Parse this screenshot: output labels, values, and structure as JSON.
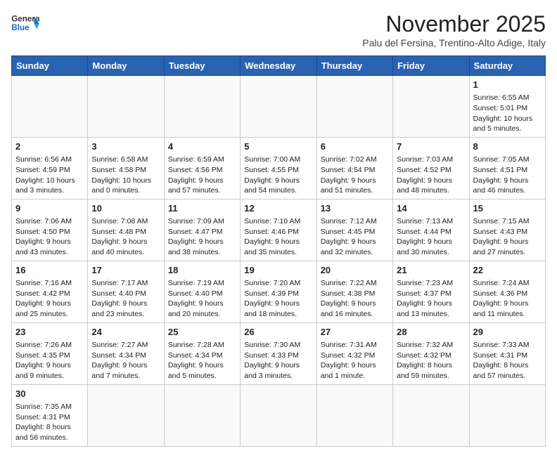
{
  "header": {
    "logo_general": "General",
    "logo_blue": "Blue",
    "month_title": "November 2025",
    "subtitle": "Palu del Fersina, Trentino-Alto Adige, Italy"
  },
  "days_of_week": [
    "Sunday",
    "Monday",
    "Tuesday",
    "Wednesday",
    "Thursday",
    "Friday",
    "Saturday"
  ],
  "weeks": [
    [
      {
        "day": "",
        "info": ""
      },
      {
        "day": "",
        "info": ""
      },
      {
        "day": "",
        "info": ""
      },
      {
        "day": "",
        "info": ""
      },
      {
        "day": "",
        "info": ""
      },
      {
        "day": "",
        "info": ""
      },
      {
        "day": "1",
        "info": "Sunrise: 6:55 AM\nSunset: 5:01 PM\nDaylight: 10 hours and 5 minutes."
      }
    ],
    [
      {
        "day": "2",
        "info": "Sunrise: 6:56 AM\nSunset: 4:59 PM\nDaylight: 10 hours and 3 minutes."
      },
      {
        "day": "3",
        "info": "Sunrise: 6:58 AM\nSunset: 4:58 PM\nDaylight: 10 hours and 0 minutes."
      },
      {
        "day": "4",
        "info": "Sunrise: 6:59 AM\nSunset: 4:56 PM\nDaylight: 9 hours and 57 minutes."
      },
      {
        "day": "5",
        "info": "Sunrise: 7:00 AM\nSunset: 4:55 PM\nDaylight: 9 hours and 54 minutes."
      },
      {
        "day": "6",
        "info": "Sunrise: 7:02 AM\nSunset: 4:54 PM\nDaylight: 9 hours and 51 minutes."
      },
      {
        "day": "7",
        "info": "Sunrise: 7:03 AM\nSunset: 4:52 PM\nDaylight: 9 hours and 48 minutes."
      },
      {
        "day": "8",
        "info": "Sunrise: 7:05 AM\nSunset: 4:51 PM\nDaylight: 9 hours and 46 minutes."
      }
    ],
    [
      {
        "day": "9",
        "info": "Sunrise: 7:06 AM\nSunset: 4:50 PM\nDaylight: 9 hours and 43 minutes."
      },
      {
        "day": "10",
        "info": "Sunrise: 7:08 AM\nSunset: 4:48 PM\nDaylight: 9 hours and 40 minutes."
      },
      {
        "day": "11",
        "info": "Sunrise: 7:09 AM\nSunset: 4:47 PM\nDaylight: 9 hours and 38 minutes."
      },
      {
        "day": "12",
        "info": "Sunrise: 7:10 AM\nSunset: 4:46 PM\nDaylight: 9 hours and 35 minutes."
      },
      {
        "day": "13",
        "info": "Sunrise: 7:12 AM\nSunset: 4:45 PM\nDaylight: 9 hours and 32 minutes."
      },
      {
        "day": "14",
        "info": "Sunrise: 7:13 AM\nSunset: 4:44 PM\nDaylight: 9 hours and 30 minutes."
      },
      {
        "day": "15",
        "info": "Sunrise: 7:15 AM\nSunset: 4:43 PM\nDaylight: 9 hours and 27 minutes."
      }
    ],
    [
      {
        "day": "16",
        "info": "Sunrise: 7:16 AM\nSunset: 4:42 PM\nDaylight: 9 hours and 25 minutes."
      },
      {
        "day": "17",
        "info": "Sunrise: 7:17 AM\nSunset: 4:40 PM\nDaylight: 9 hours and 23 minutes."
      },
      {
        "day": "18",
        "info": "Sunrise: 7:19 AM\nSunset: 4:40 PM\nDaylight: 9 hours and 20 minutes."
      },
      {
        "day": "19",
        "info": "Sunrise: 7:20 AM\nSunset: 4:39 PM\nDaylight: 9 hours and 18 minutes."
      },
      {
        "day": "20",
        "info": "Sunrise: 7:22 AM\nSunset: 4:38 PM\nDaylight: 9 hours and 16 minutes."
      },
      {
        "day": "21",
        "info": "Sunrise: 7:23 AM\nSunset: 4:37 PM\nDaylight: 9 hours and 13 minutes."
      },
      {
        "day": "22",
        "info": "Sunrise: 7:24 AM\nSunset: 4:36 PM\nDaylight: 9 hours and 11 minutes."
      }
    ],
    [
      {
        "day": "23",
        "info": "Sunrise: 7:26 AM\nSunset: 4:35 PM\nDaylight: 9 hours and 9 minutes."
      },
      {
        "day": "24",
        "info": "Sunrise: 7:27 AM\nSunset: 4:34 PM\nDaylight: 9 hours and 7 minutes."
      },
      {
        "day": "25",
        "info": "Sunrise: 7:28 AM\nSunset: 4:34 PM\nDaylight: 9 hours and 5 minutes."
      },
      {
        "day": "26",
        "info": "Sunrise: 7:30 AM\nSunset: 4:33 PM\nDaylight: 9 hours and 3 minutes."
      },
      {
        "day": "27",
        "info": "Sunrise: 7:31 AM\nSunset: 4:32 PM\nDaylight: 9 hours and 1 minute."
      },
      {
        "day": "28",
        "info": "Sunrise: 7:32 AM\nSunset: 4:32 PM\nDaylight: 8 hours and 59 minutes."
      },
      {
        "day": "29",
        "info": "Sunrise: 7:33 AM\nSunset: 4:31 PM\nDaylight: 8 hours and 57 minutes."
      }
    ],
    [
      {
        "day": "30",
        "info": "Sunrise: 7:35 AM\nSunset: 4:31 PM\nDaylight: 8 hours and 56 minutes."
      },
      {
        "day": "",
        "info": ""
      },
      {
        "day": "",
        "info": ""
      },
      {
        "day": "",
        "info": ""
      },
      {
        "day": "",
        "info": ""
      },
      {
        "day": "",
        "info": ""
      },
      {
        "day": "",
        "info": ""
      }
    ]
  ]
}
